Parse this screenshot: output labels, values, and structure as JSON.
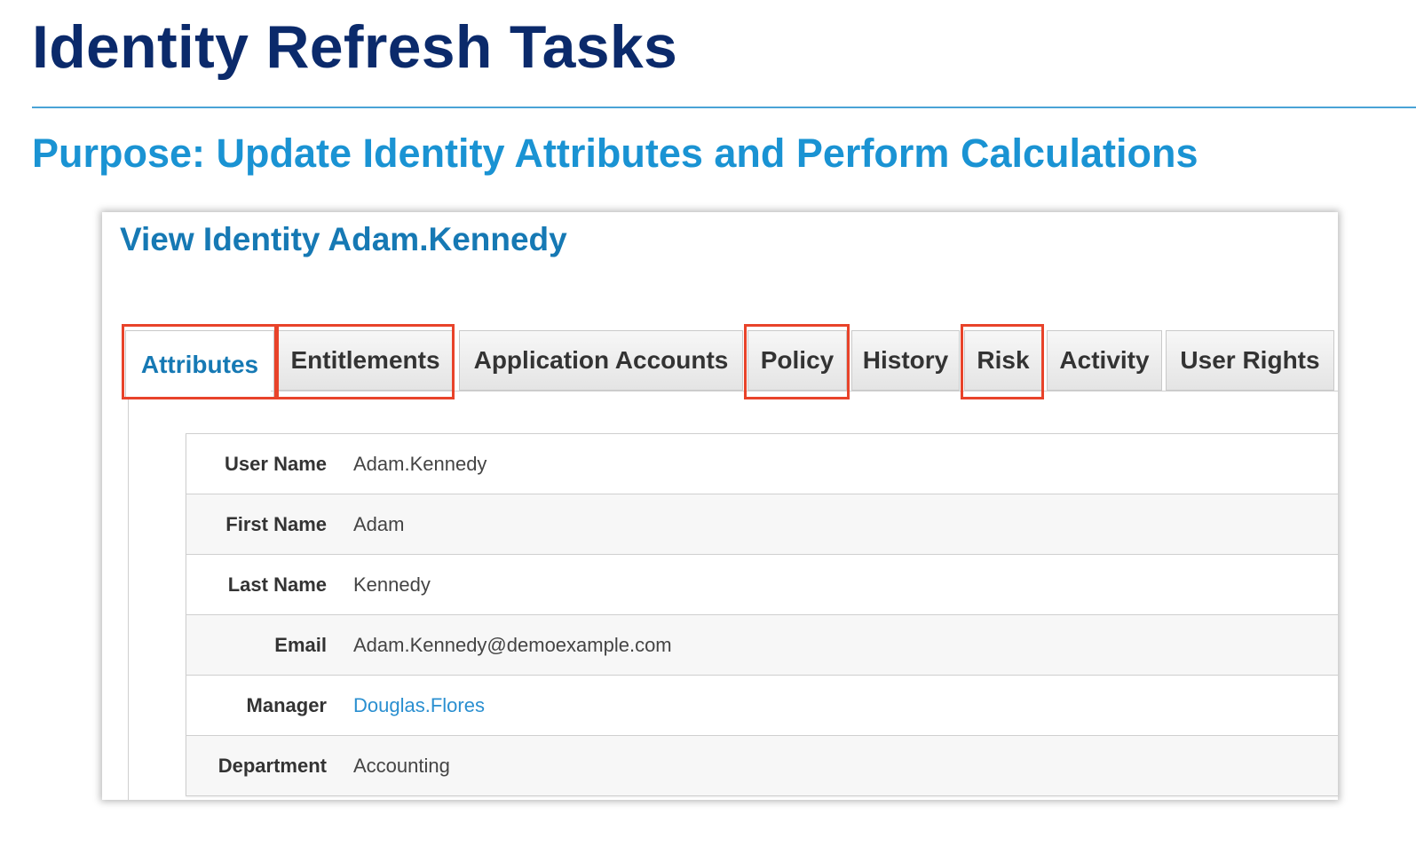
{
  "slide": {
    "title": "Identity Refresh Tasks",
    "subtitle": "Purpose: Update Identity Attributes and Perform Calculations"
  },
  "screenshot": {
    "title": "View Identity Adam.Kennedy",
    "tabs": [
      {
        "label": "Attributes",
        "active": true,
        "highlighted": true
      },
      {
        "label": "Entitlements",
        "active": false,
        "highlighted": true
      },
      {
        "label": "Application Accounts",
        "active": false,
        "highlighted": false
      },
      {
        "label": "Policy",
        "active": false,
        "highlighted": true
      },
      {
        "label": "History",
        "active": false,
        "highlighted": false
      },
      {
        "label": "Risk",
        "active": false,
        "highlighted": true
      },
      {
        "label": "Activity",
        "active": false,
        "highlighted": false
      },
      {
        "label": "User Rights",
        "active": false,
        "highlighted": false
      }
    ],
    "attributes": [
      {
        "label": "User Name",
        "value": "Adam.Kennedy"
      },
      {
        "label": "First Name",
        "value": "Adam"
      },
      {
        "label": "Last Name",
        "value": "Kennedy"
      },
      {
        "label": "Email",
        "value": "Adam.Kennedy@demoexample.com"
      },
      {
        "label": "Manager",
        "value": "Douglas.Flores",
        "is_link": true
      },
      {
        "label": "Department",
        "value": "Accounting"
      }
    ]
  },
  "colors": {
    "title": "#0b2a6b",
    "subtitle": "#1a93d3",
    "screenshot_title": "#1679b4",
    "link": "#2a8fd0",
    "highlight_box": "#e8432a"
  }
}
